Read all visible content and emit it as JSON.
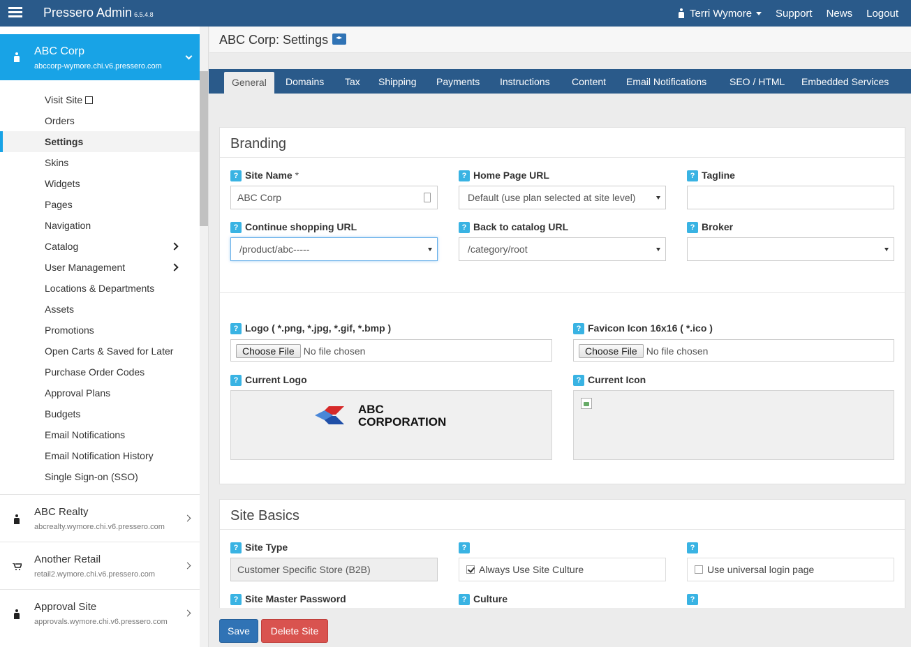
{
  "app": {
    "title": "Pressero Admin",
    "version": "6.5.4.8"
  },
  "topnav": {
    "user": "Terri Wymore",
    "support": "Support",
    "news": "News",
    "logout": "Logout"
  },
  "active_site": {
    "name": "ABC Corp",
    "url": "abccorp-wymore.chi.v6.pressero.com"
  },
  "menu": [
    "Visit Site",
    "Orders",
    "Settings",
    "Skins",
    "Widgets",
    "Pages",
    "Navigation",
    "Catalog",
    "User Management",
    "Locations & Departments",
    "Assets",
    "Promotions",
    "Open Carts & Saved for Later",
    "Purchase Order Codes",
    "Approval Plans",
    "Budgets",
    "Email Notifications",
    "Email Notification History",
    "Single Sign-on (SSO)"
  ],
  "sites": [
    {
      "name": "ABC Realty",
      "url": "abcrealty.wymore.chi.v6.pressero.com"
    },
    {
      "name": "Another Retail",
      "url": "retail2.wymore.chi.v6.pressero.com"
    },
    {
      "name": "Approval Site",
      "url": "approvals.wymore.chi.v6.pressero.com"
    }
  ],
  "page": {
    "title": "ABC Corp: Settings"
  },
  "tabs": [
    "General",
    "Domains",
    "Tax",
    "Shipping",
    "Payments",
    "Instructions",
    "Content",
    "Email Notifications",
    "SEO / HTML",
    "Embedded Services"
  ],
  "branding": {
    "heading": "Branding",
    "site_name_label": "Site Name",
    "site_name_required": "*",
    "site_name_value": "ABC Corp",
    "home_url_label": "Home Page URL",
    "home_url_value": "Default (use plan selected at site level)",
    "tagline_label": "Tagline",
    "tagline_value": "",
    "continue_label": "Continue shopping URL",
    "continue_value": "/product/abc-----",
    "catalog_label": "Back to catalog URL",
    "catalog_value": "/category/root",
    "broker_label": "Broker",
    "broker_value": "",
    "logo_label": "Logo ( *.png, *.jpg, *.gif, *.bmp )",
    "favicon_label": "Favicon Icon 16x16 ( *.ico )",
    "choose_file": "Choose File",
    "no_file": "No file chosen",
    "current_logo_label": "Current Logo",
    "current_icon_label": "Current Icon",
    "logo_line1": "ABC",
    "logo_line2": "CORPORATION"
  },
  "site_basics": {
    "heading": "Site Basics",
    "site_type_label": "Site Type",
    "site_type_value": "Customer Specific Store (B2B)",
    "always_culture": "Always Use Site Culture",
    "universal_login": "Use universal login page",
    "master_pw_label": "Site Master Password",
    "culture_label": "Culture"
  },
  "footer": {
    "save": "Save",
    "delete": "Delete Site"
  },
  "colors": {
    "topbar": "#2a5a8a",
    "accent": "#18a3e6",
    "save": "#3073b5",
    "delete": "#d9534f"
  }
}
